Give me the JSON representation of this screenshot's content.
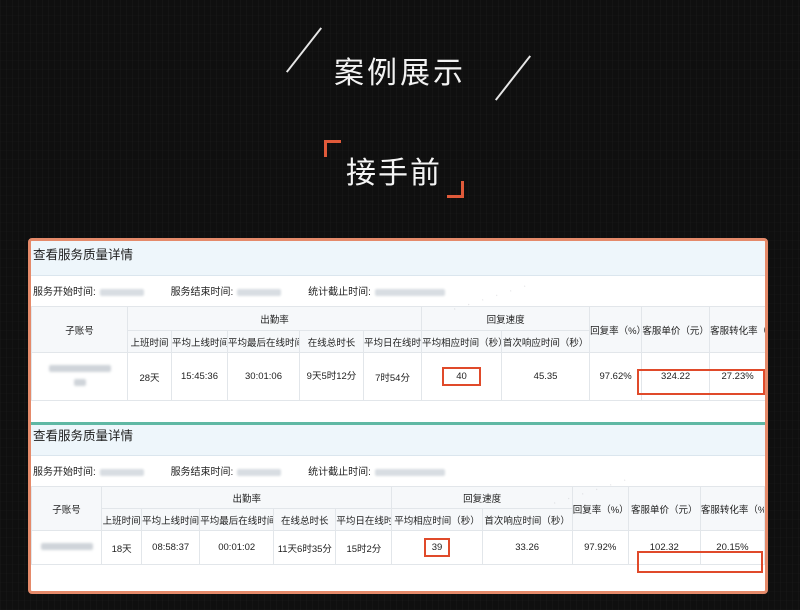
{
  "header": {
    "title": "案例展示",
    "subtitle": "接手前"
  },
  "panels": [
    {
      "heading": "查看服务质量详情",
      "meta": {
        "start_label": "服务开始时间:",
        "end_label": "服务结束时间:",
        "stat_label": "统计截止时间:"
      },
      "columns": {
        "account": "子账号",
        "attendance_group": "出勤率",
        "speed_group": "回复速度",
        "reply_rate": "回复率（%）",
        "unit_price": "客服单价（元）",
        "conversion": "客服转化率（%",
        "sub": [
          "上班时间",
          "平均上线时间",
          "平均最后在线时间",
          "在线总时长",
          "平均日在线时间",
          "平均相应时间（秒）",
          "首次响应时间（秒）"
        ]
      },
      "row": {
        "days": "28天",
        "avg_online": "15:45:36",
        "avg_last_online": "30:01:06",
        "total_online": "9天5时12分",
        "daily_online": "7时54分",
        "avg_response": "40",
        "first_response": "45.35",
        "reply_rate": "97.62%",
        "unit_price": "324.22",
        "conversion": "27.23%"
      }
    },
    {
      "heading": "查看服务质量详情",
      "meta": {
        "start_label": "服务开始时间:",
        "end_label": "服务结束时间:",
        "stat_label": "统计截止时间:"
      },
      "columns": {
        "account": "子账号",
        "attendance_group": "出勤率",
        "speed_group": "回复速度",
        "reply_rate": "回复率（%）",
        "unit_price": "客服单价（元）",
        "conversion": "客服转化率（%",
        "sub": [
          "上班时间",
          "平均上线时间",
          "平均最后在线时间",
          "在线总时长",
          "平均日在线时间",
          "平均相应时间（秒）",
          "首次响应时间（秒）"
        ]
      },
      "row": {
        "days": "18天",
        "avg_online": "08:58:37",
        "avg_last_online": "00:01:02",
        "total_online": "11天6时35分",
        "daily_online": "15时2分",
        "avg_response": "39",
        "first_response": "33.26",
        "reply_rate": "97.92%",
        "unit_price": "102.32",
        "conversion": "20.15%"
      }
    }
  ],
  "colors": {
    "accent": "#e05a3a",
    "highlight": "#e04a2a",
    "separator": "#5fb8a4"
  }
}
